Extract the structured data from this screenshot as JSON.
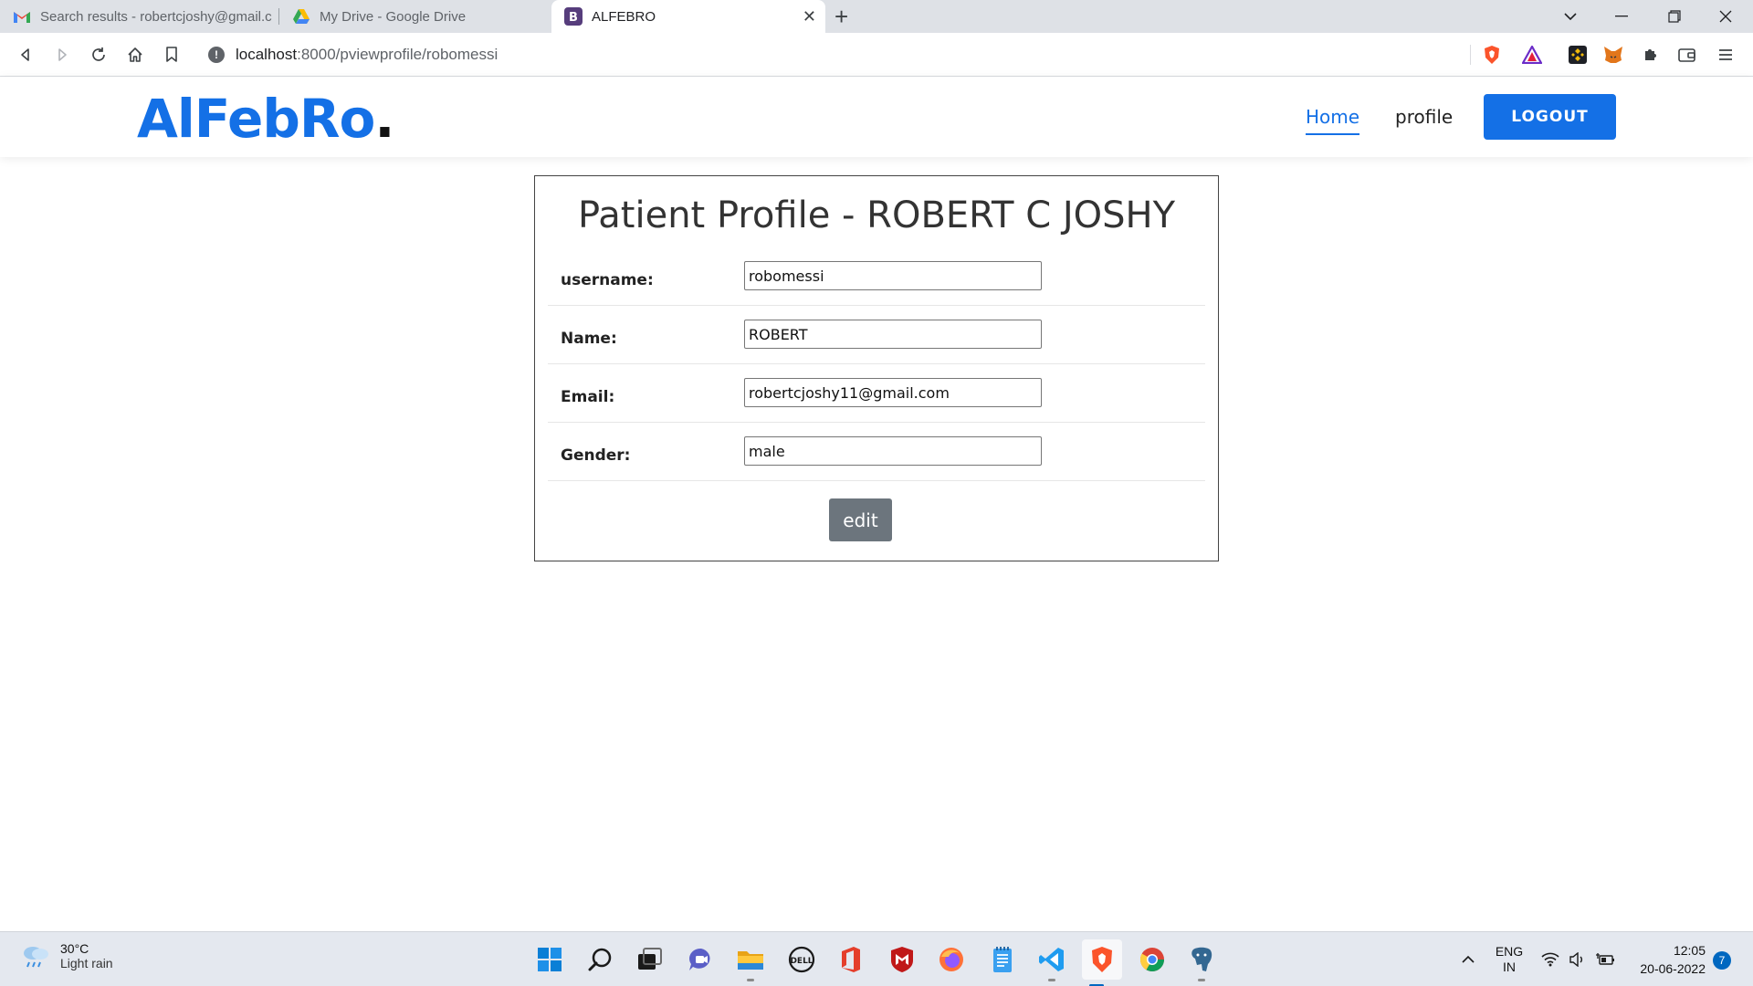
{
  "browser": {
    "tabs": [
      {
        "title": "Search results - robertcjoshy@gmail.c",
        "favicon": "gmail-icon"
      },
      {
        "title": "My Drive - Google Drive",
        "favicon": "google-drive-icon"
      },
      {
        "title": "ALFEBRO",
        "favicon": "bootstrap-icon",
        "active": true
      }
    ],
    "url_host": "localhost",
    "url_path": ":8000/pviewprofile/robomessi"
  },
  "site": {
    "logo_main": "AlFebRo",
    "logo_dot": ".",
    "nav": {
      "home": "Home",
      "profile": "profile",
      "logout": "LOGOUT"
    },
    "accent_color": "#1470e6"
  },
  "profile": {
    "title": "Patient Profile - ROBERT C JOSHY",
    "fields": [
      {
        "label": "username:",
        "value": "robomessi"
      },
      {
        "label": "Name:",
        "value": "ROBERT"
      },
      {
        "label": "Email:",
        "value": "robertcjoshy11@gmail.com"
      },
      {
        "label": "Gender:",
        "value": "male"
      }
    ],
    "edit_label": "edit"
  },
  "taskbar": {
    "weather_temp": "30°C",
    "weather_desc": "Light rain",
    "lang_top": "ENG",
    "lang_bottom": "IN",
    "time": "12:05",
    "date": "20-06-2022",
    "notification_count": "7"
  }
}
